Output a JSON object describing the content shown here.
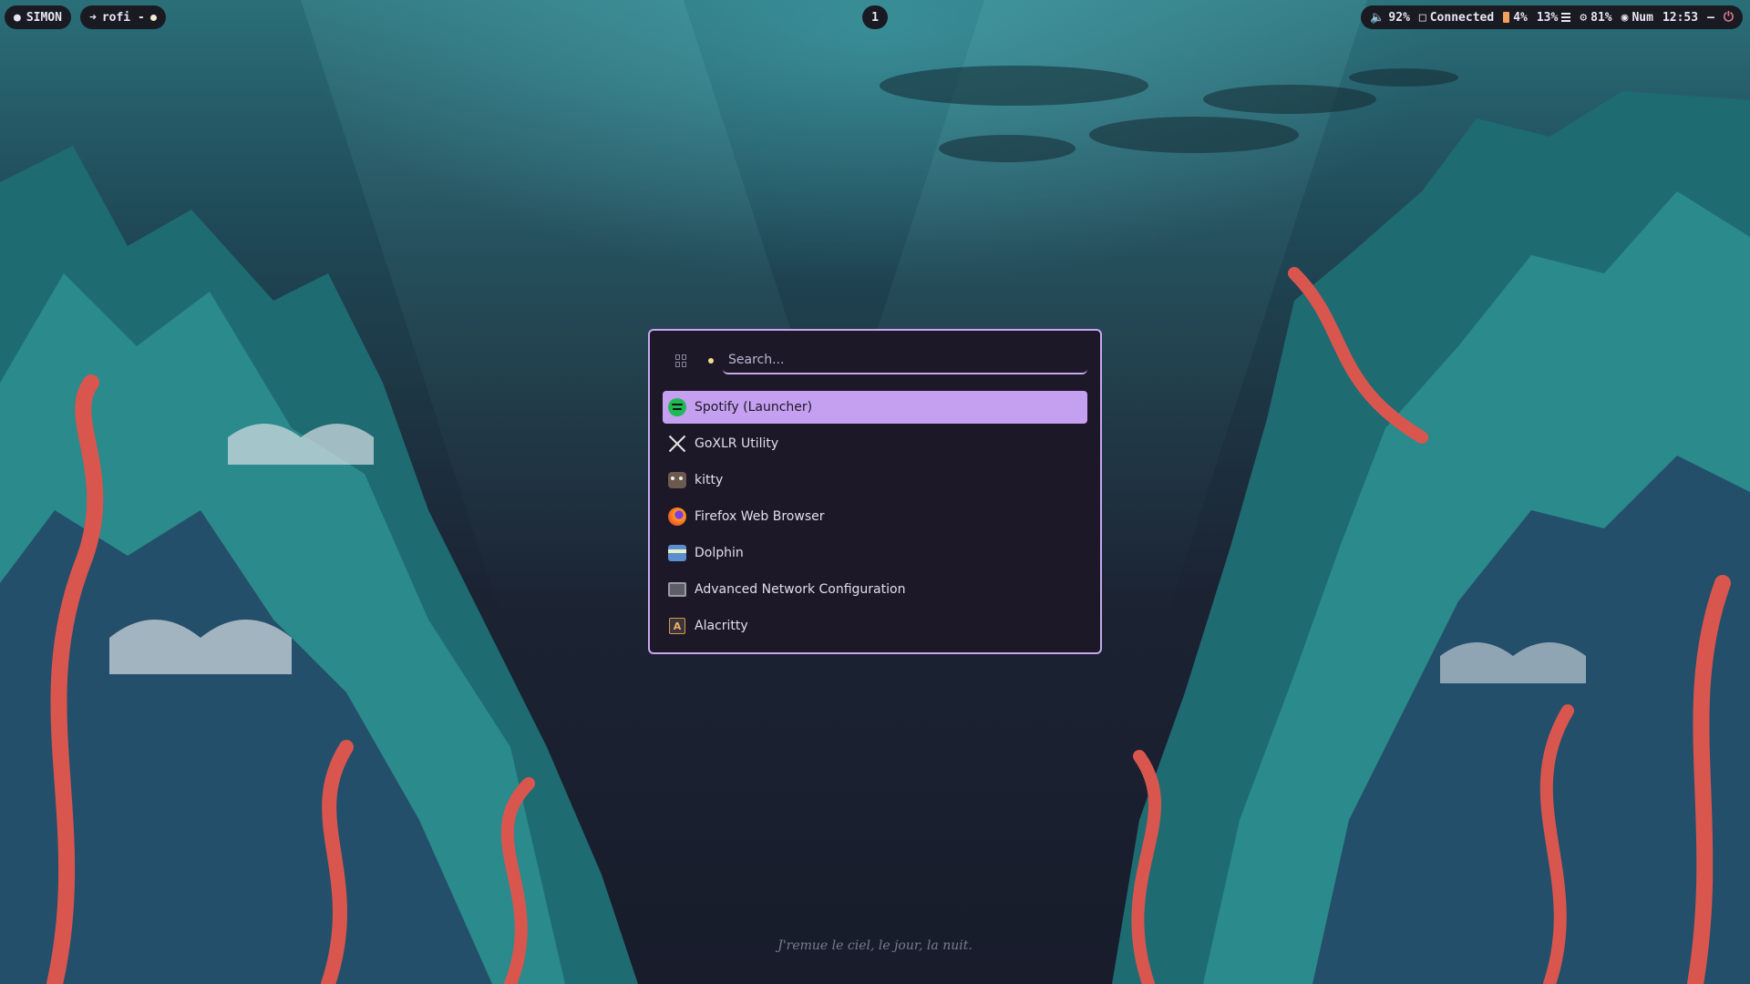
{
  "topbar": {
    "user": "SIMON",
    "window": "rofi -",
    "workspace": "1",
    "volume": "92%",
    "network": "Connected",
    "battery": "4%",
    "cpu": "13%",
    "memory": "81%",
    "numlock": "Num",
    "clock": "12:53"
  },
  "rofi": {
    "search_placeholder": "Search...",
    "items": [
      {
        "label": "Spotify (Launcher)",
        "icon": "spotify-icon",
        "selected": true
      },
      {
        "label": "GoXLR Utility",
        "icon": "goxlr-icon"
      },
      {
        "label": "kitty",
        "icon": "kitty-icon"
      },
      {
        "label": "Firefox Web Browser",
        "icon": "firefox-icon"
      },
      {
        "label": "Dolphin",
        "icon": "dolphin-icon"
      },
      {
        "label": "Advanced Network Configuration",
        "icon": "network-config-icon"
      },
      {
        "label": "Alacritty",
        "icon": "alacritty-icon"
      }
    ]
  },
  "wallpaper": {
    "caption": "J'remue le ciel, le jour, la nuit."
  },
  "colors": {
    "accent": "#c59ff0",
    "panel": "#1c1827",
    "bar": "#1a1a22"
  }
}
